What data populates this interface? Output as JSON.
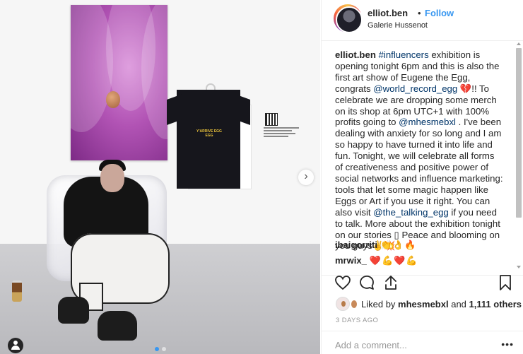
{
  "header": {
    "username": "elliot.ben",
    "separator": "•",
    "follow_label": "Follow",
    "location": "Galerie Hussenot"
  },
  "photo": {
    "shirt_print": "Y'ARRIVE EGG EGG",
    "carousel_next_icon": "chevron-right-icon",
    "user_tag_icon": "user-icon",
    "carousel_dots": 2,
    "carousel_active": 1
  },
  "caption": {
    "username": "elliot.ben",
    "parts": [
      {
        "t": " ",
        "link": false
      },
      {
        "t": "#influencers",
        "link": true
      },
      {
        "t": " exhibition is opening tonight 6pm and this is also the first art show of Eugene the Egg, congrats ",
        "link": false
      },
      {
        "t": "@world_record_egg",
        "link": true
      },
      {
        "t": " 💔!! To celebrate we are dropping some merch on its shop at 6pm UTC+1 with 100% profits going to ",
        "link": false
      },
      {
        "t": "@mhesmebxl",
        "link": true
      },
      {
        "t": " . I've been dealing with anxiety for so long and I am so happy to have turned it into life and fun. Tonight, we will celebrate all forms of creativeness and positive power of social networks and influence marketing: tools that let some magic happen like Eggs or Art if you use it right. You can also visit ",
        "link": false
      },
      {
        "t": "@the_talking_egg",
        "link": true
      },
      {
        "t": " if you need to talk. More about the exhibition tonight on our stories ▯ Peace and blooming on you guys✌💥",
        "link": false
      }
    ]
  },
  "comments": [
    {
      "user": "ibaigorriti",
      "text": "👏👌🔥"
    },
    {
      "user": "mrwix_",
      "text": "❤️💪❤️💪"
    }
  ],
  "actions": {
    "like_icon": "heart-outline-icon",
    "comment_icon": "comment-bubble-icon",
    "share_icon": "share-arrow-icon",
    "save_icon": "bookmark-icon"
  },
  "likes": {
    "prefix": "Liked by ",
    "user": "mhesmebxl",
    "middle": " and ",
    "count": "1,111 others"
  },
  "date": "3 DAYS AGO",
  "add_comment": {
    "placeholder": "Add a comment...",
    "more": "•••"
  },
  "colors": {
    "link": "#003569",
    "follow": "#3897f0",
    "text": "#262626",
    "muted": "#999999"
  }
}
